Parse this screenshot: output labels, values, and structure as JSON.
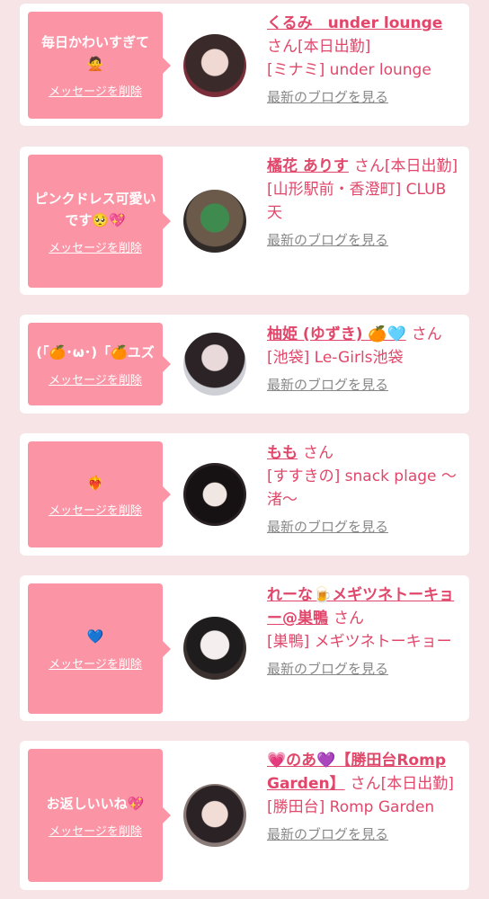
{
  "delete_label": "メッセージを削除",
  "blog_label": "最新のブログを見る",
  "san": "さん",
  "colors": {
    "bubble": "#fb95a6",
    "accent": "#e0476a",
    "background": "#f7e4e6"
  },
  "items": [
    {
      "message": "毎日かわいすぎて🙅",
      "name": "くるみ　under lounge",
      "status": "[本日出勤]",
      "shop": "[ミナミ] under lounge"
    },
    {
      "message": "ピンクドレス可愛いです🥺💖",
      "name": "橘花 ありす",
      "status": "[本日出勤]",
      "shop": "[山形駅前・香澄町] CLUB 天"
    },
    {
      "message": "(「🍊･ω･)「🍊ユズ",
      "name": "柚姫 (ゆずき) 🍊🩵",
      "status": "",
      "shop": "[池袋] Le-Girls池袋"
    },
    {
      "message": "❤️‍🔥",
      "name": "もも",
      "status": "",
      "shop": "[すすきの] snack plage ～渚～"
    },
    {
      "message": "💙",
      "name": "れーな🍺メギツネトーキョー@巣鴨",
      "status": "",
      "shop": "[巣鴨] メギツネトーキョー"
    },
    {
      "message": "お返しいいね💖",
      "name": "💗のあ💜【勝田台Romp Garden】",
      "status": "[本日出勤]",
      "shop": "[勝田台] Romp Garden"
    }
  ]
}
